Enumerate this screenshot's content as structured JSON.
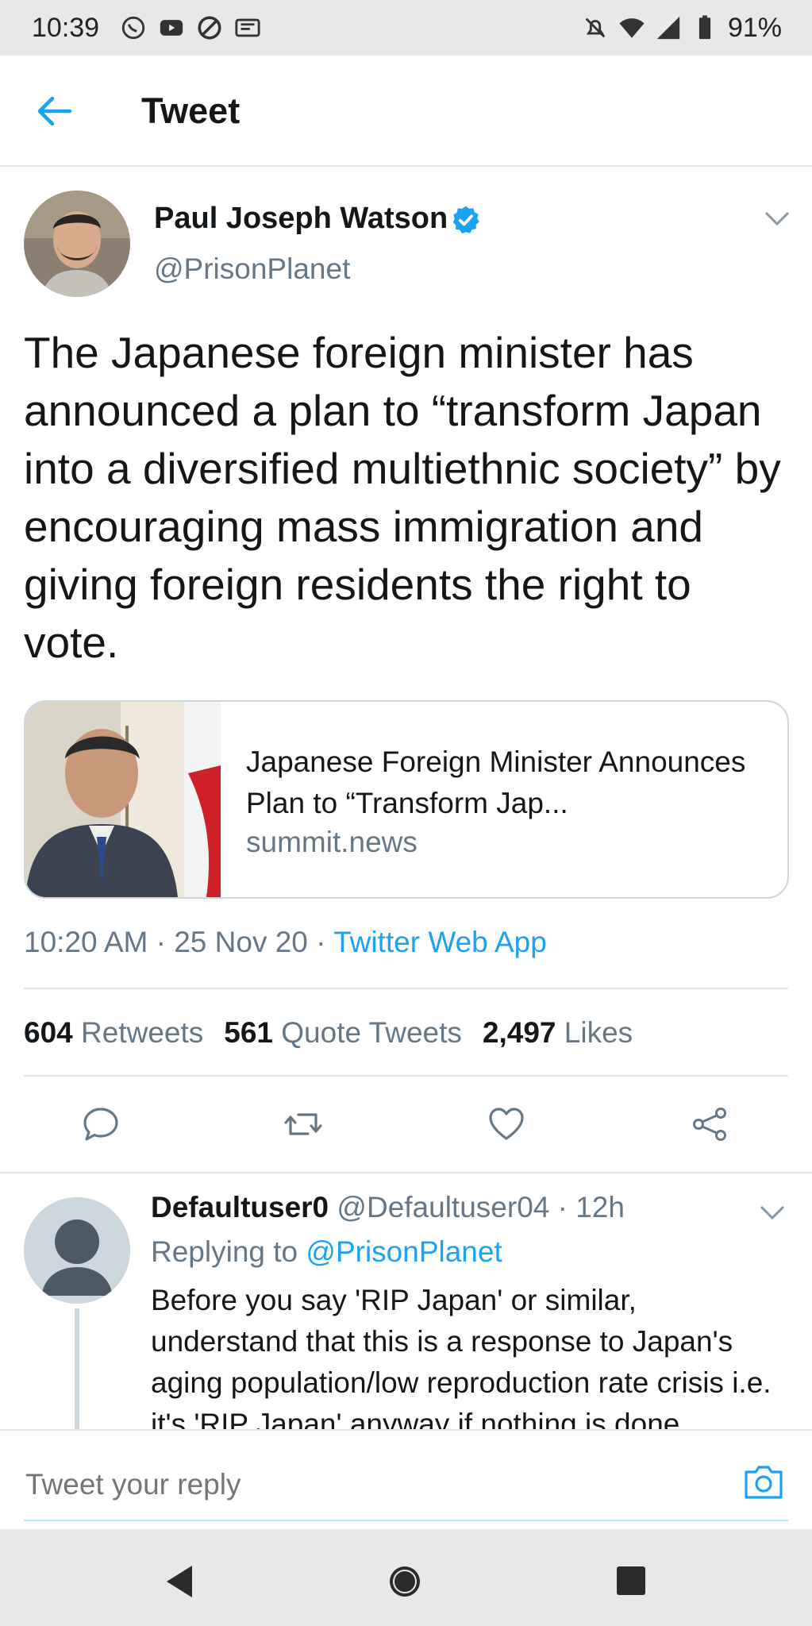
{
  "status_bar": {
    "time": "10:39",
    "battery": "91%",
    "left_icons": [
      "whatsapp-icon",
      "youtube-icon",
      "blocked-icon",
      "cast-icon"
    ],
    "right_icons": [
      "silent-icon",
      "wifi-icon",
      "signal-icon",
      "battery-icon"
    ]
  },
  "header": {
    "title": "Tweet"
  },
  "tweet": {
    "author_name": "Paul Joseph Watson",
    "author_handle": "@PrisonPlanet",
    "verified": true,
    "text": "The Japanese foreign minister has announced a plan to “transform Japan into a diversified multiethnic society” by encouraging mass immigration and giving foreign residents the right to vote.",
    "card": {
      "title": "Japanese Foreign Minister Announces Plan to “Transform Jap...",
      "domain": "summit.news"
    },
    "timestamp": "10:20 AM · 25 Nov 20 · ",
    "source": "Twitter Web App",
    "stats": {
      "retweets_count": "604",
      "retweets_label": "Retweets",
      "quotes_count": "561",
      "quotes_label": "Quote Tweets",
      "likes_count": "2,497",
      "likes_label": "Likes"
    }
  },
  "reply": {
    "author_name": "Defaultuser0",
    "handle_time": " @Defaultuser04 · 12h",
    "replying_label": "Replying to ",
    "replying_to": "@PrisonPlanet",
    "text": "Before you say 'RIP Japan' or similar, understand that this is a response to Japan's aging population/low reproduction rate crisis i.e. it's 'RIP Japan' anyway if nothing is done."
  },
  "composer": {
    "placeholder": "Tweet your reply"
  },
  "colors": {
    "accent": "#1da1f2",
    "text": "#14171a",
    "secondary": "#657786",
    "divider": "#e1e8ed"
  }
}
